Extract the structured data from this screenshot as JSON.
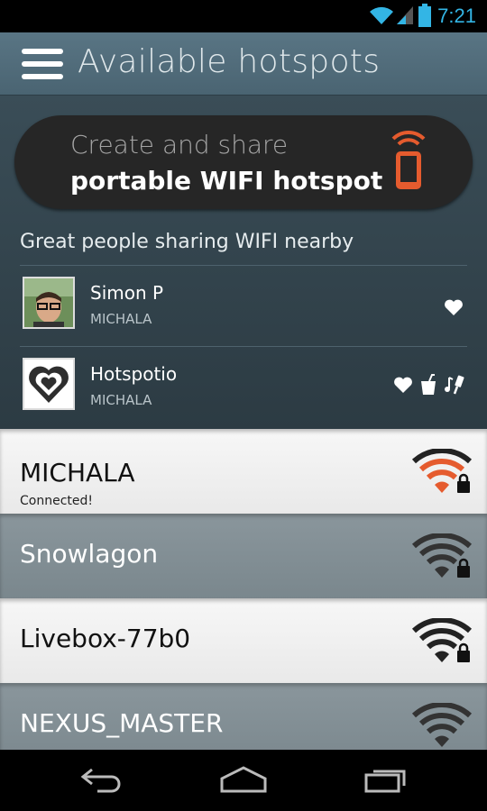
{
  "status_bar": {
    "time": "7:21",
    "wifi_icon": "wifi-icon",
    "signal_icon": "signal-icon",
    "battery_icon": "battery-icon"
  },
  "app_bar": {
    "title": "Available hotspots",
    "menu_icon": "menu-icon"
  },
  "create_card": {
    "line1": "Create and share",
    "line2": "portable WIFI hotspot",
    "icon": "phone-broadcast-icon",
    "accent": "#e55b2e"
  },
  "sharing": {
    "heading": "Great people sharing WIFI nearby",
    "people": [
      {
        "name": "Simon P",
        "network": "MICHALA",
        "icons": [
          "heart-icon"
        ]
      },
      {
        "name": "Hotspotio",
        "network": "MICHALA",
        "icons": [
          "heart-icon",
          "drink-icon",
          "music-icon"
        ]
      }
    ]
  },
  "hotspots": [
    {
      "name": "MICHALA",
      "status": "Connected!",
      "secured": true,
      "connected": true
    },
    {
      "name": "Snowlagon",
      "secured": true,
      "connected": false
    },
    {
      "name": "Livebox-77b0",
      "secured": true,
      "connected": false
    },
    {
      "name": "NEXUS_MASTER",
      "secured": false,
      "connected": false
    }
  ],
  "nav_bar": {
    "back_icon": "back-icon",
    "home_icon": "home-icon",
    "recents_icon": "recents-icon"
  },
  "colors": {
    "accent_blue": "#33b5e5",
    "accent_orange": "#e55b2e",
    "appbar": "#4f6a78"
  }
}
